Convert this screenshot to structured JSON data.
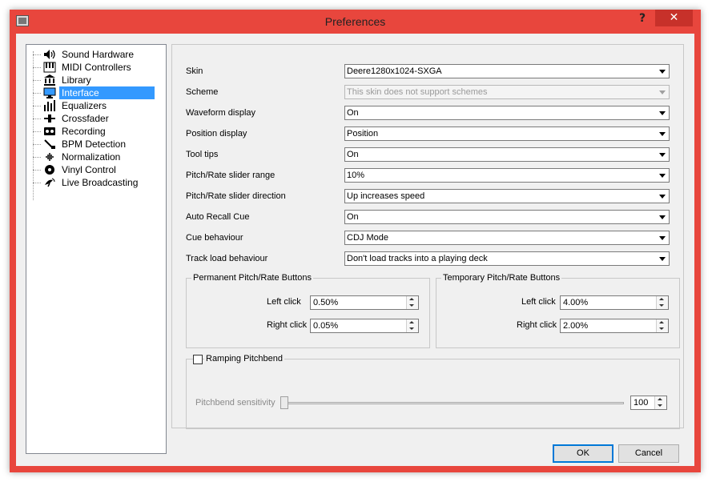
{
  "window": {
    "title": "Preferences",
    "help_label": "?",
    "close_label": "✕"
  },
  "sidebar": {
    "items": [
      {
        "label": "Sound Hardware",
        "icon": "speaker-icon"
      },
      {
        "label": "MIDI Controllers",
        "icon": "midi-keyboard-icon"
      },
      {
        "label": "Library",
        "icon": "library-icon"
      },
      {
        "label": "Interface",
        "icon": "monitor-icon",
        "selected": true
      },
      {
        "label": "Equalizers",
        "icon": "equalizer-icon"
      },
      {
        "label": "Crossfader",
        "icon": "crossfader-icon"
      },
      {
        "label": "Recording",
        "icon": "recording-icon"
      },
      {
        "label": "BPM Detection",
        "icon": "bpm-icon"
      },
      {
        "label": "Normalization",
        "icon": "normalization-icon"
      },
      {
        "label": "Vinyl Control",
        "icon": "vinyl-icon"
      },
      {
        "label": "Live Broadcasting",
        "icon": "broadcast-icon"
      }
    ]
  },
  "settings": [
    {
      "label": "Skin",
      "value": "Deere1280x1024-SXGA"
    },
    {
      "label": "Scheme",
      "value": "This skin does not support schemes",
      "disabled": true
    },
    {
      "label": "Waveform display",
      "value": "On"
    },
    {
      "label": "Position display",
      "value": "Position"
    },
    {
      "label": "Tool tips",
      "value": "On"
    },
    {
      "label": "Pitch/Rate slider range",
      "value": "10%"
    },
    {
      "label": "Pitch/Rate slider direction",
      "value": "Up increases speed"
    },
    {
      "label": "Auto Recall Cue",
      "value": "On"
    },
    {
      "label": "Cue behaviour",
      "value": "CDJ Mode"
    },
    {
      "label": "Track load behaviour",
      "value": "Don't load tracks into a playing deck"
    }
  ],
  "permanent_group": {
    "title": "Permanent Pitch/Rate Buttons",
    "left_label": "Left click",
    "left_value": "0.50%",
    "right_label": "Right click",
    "right_value": "0.05%"
  },
  "temporary_group": {
    "title": "Temporary Pitch/Rate Buttons",
    "left_label": "Left click",
    "left_value": "4.00%",
    "right_label": "Right click",
    "right_value": "2.00%"
  },
  "ramping": {
    "checkbox_label": "Ramping Pitchbend",
    "checked": false,
    "sensitivity_label": "Pitchbend sensitivity",
    "sensitivity_value": "100"
  },
  "buttons": {
    "ok": "OK",
    "cancel": "Cancel"
  },
  "colors": {
    "accent": "#3399ff",
    "titlebar": "#e8463d",
    "close": "#c7312a"
  }
}
